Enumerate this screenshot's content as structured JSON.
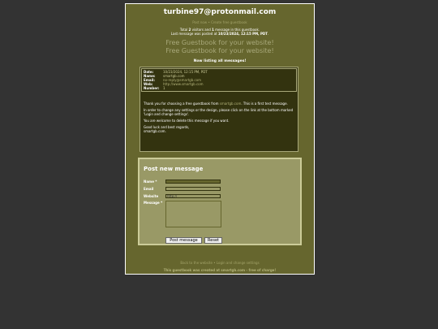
{
  "header": {
    "title": "turbine97@protonmail.com",
    "links": [
      "Post now",
      "Create free guestbook"
    ],
    "links_sep": "•"
  },
  "stats": {
    "line1_pre": "Total ",
    "visitors": "2",
    "line1_mid": " visitors and ",
    "messages": "1",
    "line1_post": " message in this guestbook.",
    "line2_pre": "Last message was posted at ",
    "last_posted": "10/23/2024, 12:15 PM, PDT",
    "line2_post": "."
  },
  "promo": [
    "Free Guestbook for your website!",
    "Free Guestbook for your website!"
  ],
  "listing": "Now listing all messages!",
  "message": {
    "fields": [
      {
        "label": "Date:",
        "value": "10/23/2024, 12:15 PM, PDT"
      },
      {
        "label": "Name:",
        "value": "smartgb.com"
      },
      {
        "label": "Email:",
        "value": "no-reply@smartgb.com"
      },
      {
        "label": "Web:",
        "value": "http://www.smartgb.com"
      },
      {
        "label": "Number:",
        "value": "1"
      }
    ],
    "body": {
      "p1_pre": "Thank you for choosing a free guestbook from ",
      "p1_link": "smartgb.com",
      "p1_post": ". This is a first test message.",
      "p2": "In order to change any settings or the design, please click on the link at the bottom marked 'Login and change settings'.",
      "p3": "You are welcome to delete this message if you want.",
      "p4": "Good luck and best regards,",
      "p5": "smartgb.com."
    }
  },
  "form": {
    "title": "Post new message",
    "name_label": "Name *",
    "email_label": "Email",
    "website_label": "Website",
    "website_value": "http://",
    "message_label": "Message *",
    "post_button": "Post message",
    "reset_button": "Reset"
  },
  "footer": {
    "links": [
      "Back to the website",
      "Login and change settings"
    ],
    "links_sep": "•",
    "credit": "This guestbook was created at smartgb.com - free of charge!"
  }
}
